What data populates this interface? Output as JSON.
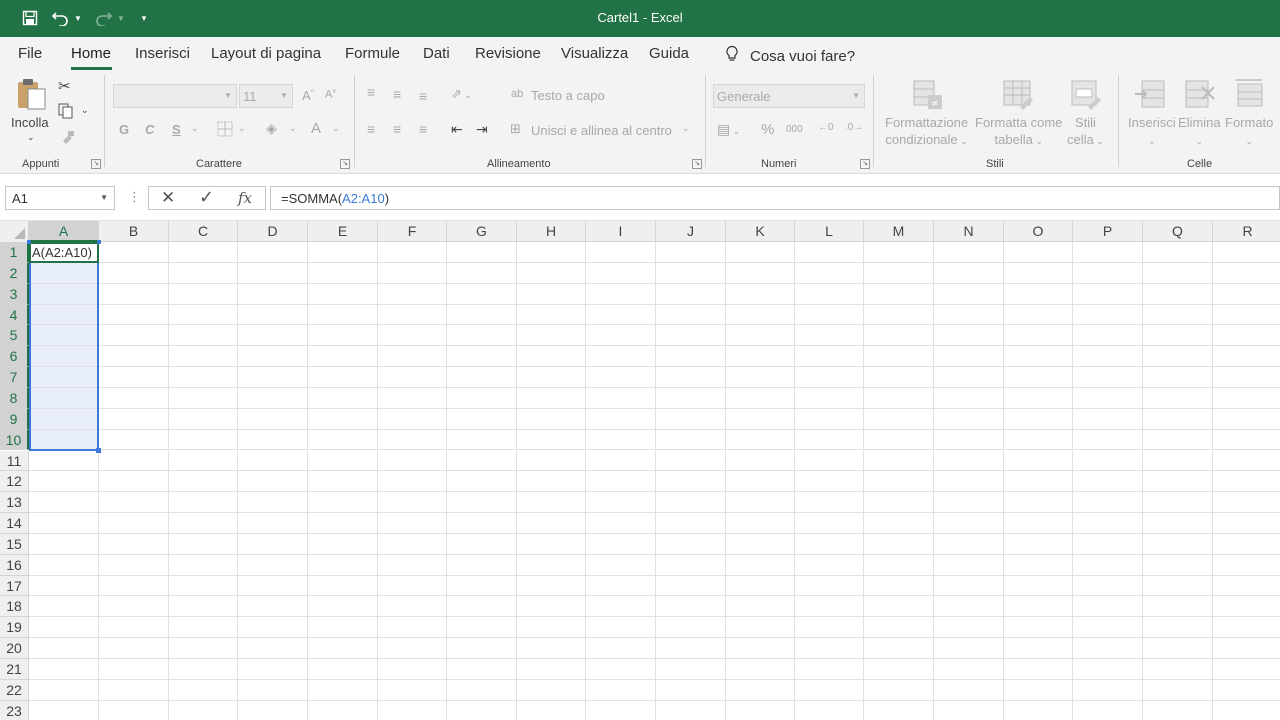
{
  "window": {
    "title": "Cartel1  -  Excel"
  },
  "tabs": [
    "File",
    "Home",
    "Inserisci",
    "Layout di pagina",
    "Formule",
    "Dati",
    "Revisione",
    "Visualizza",
    "Guida"
  ],
  "active_tab": "Home",
  "tell_me": "Cosa vuoi fare?",
  "ribbon": {
    "clipboard": {
      "paste_label": "Incolla",
      "group_label": "Appunti"
    },
    "font": {
      "font_name": "",
      "font_size": "11",
      "bold": "G",
      "italic": "C",
      "underline": "S",
      "group_label": "Carattere"
    },
    "alignment": {
      "wrap_text": "Testo a capo",
      "merge_center": "Unisci e allinea al centro",
      "group_label": "Allineamento"
    },
    "number": {
      "format": "Generale",
      "percent": "%",
      "thousands": "000",
      "group_label": "Numeri"
    },
    "styles": {
      "conditional": "Formattazione",
      "conditional2": "condizionale",
      "format_table": "Formatta come",
      "format_table2": "tabella",
      "cell_styles": "Stili",
      "cell_styles2": "cella",
      "group_label": "Stili"
    },
    "cells": {
      "insert": "Inserisci",
      "delete": "Elimina",
      "format": "Formato",
      "group_label": "Celle"
    }
  },
  "formula_bar": {
    "name_box": "A1",
    "fx": "fx",
    "formula_prefix": "=SOMMA(",
    "formula_ref": "A2:A10",
    "formula_suffix": ")"
  },
  "grid": {
    "columns": [
      "A",
      "B",
      "C",
      "D",
      "E",
      "F",
      "G",
      "H",
      "I",
      "J",
      "K",
      "L",
      "M",
      "N",
      "O",
      "P",
      "Q",
      "R"
    ],
    "rows": [
      "1",
      "2",
      "3",
      "4",
      "5",
      "6",
      "7",
      "8",
      "9",
      "10",
      "11",
      "12",
      "13",
      "14",
      "15",
      "16",
      "17",
      "18",
      "19",
      "20",
      "21",
      "22",
      "23"
    ],
    "active_cell_text": "A(A2:A10)"
  },
  "colors": {
    "excel_green": "#217346",
    "range_blue": "#3c78d8"
  }
}
